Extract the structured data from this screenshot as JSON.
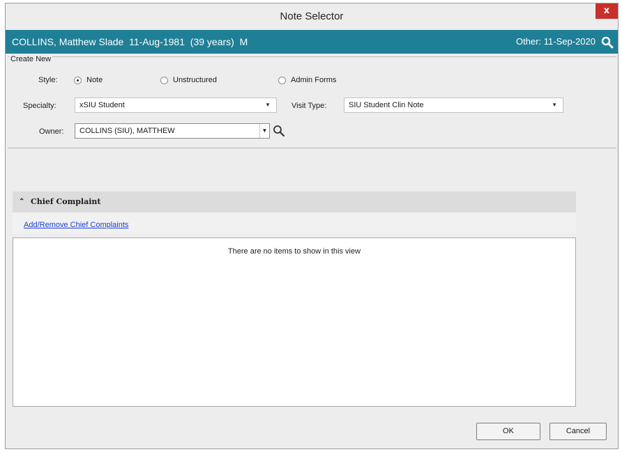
{
  "window": {
    "title": "Note Selector",
    "close_label": "x"
  },
  "patient": {
    "name": "COLLINS, Matthew Slade",
    "dob": "11-Aug-1981",
    "age": "(39 years)",
    "sex": "M",
    "other": "Other: 11-Sep-2020"
  },
  "create_new": {
    "legend": "Create New",
    "style_label": "Style:",
    "style_options": [
      "Note",
      "Unstructured",
      "Admin Forms"
    ],
    "style_selected": "Note",
    "specialty_label": "Specialty:",
    "specialty_value": "xSIU Student",
    "visit_type_label": "Visit Type:",
    "visit_type_value": "SIU Student Clin Note",
    "owner_label": "Owner:",
    "owner_value": "COLLINS (SIU), MATTHEW"
  },
  "chief_complaint": {
    "title": "Chief Complaint",
    "link": "Add/Remove Chief Complaints",
    "empty_message": "There are no items to show in this view"
  },
  "buttons": {
    "ok": "OK",
    "cancel": "Cancel"
  },
  "colors": {
    "patient_bar": "#1f7f96",
    "close": "#c8302b",
    "link": "#1a3fd6"
  }
}
